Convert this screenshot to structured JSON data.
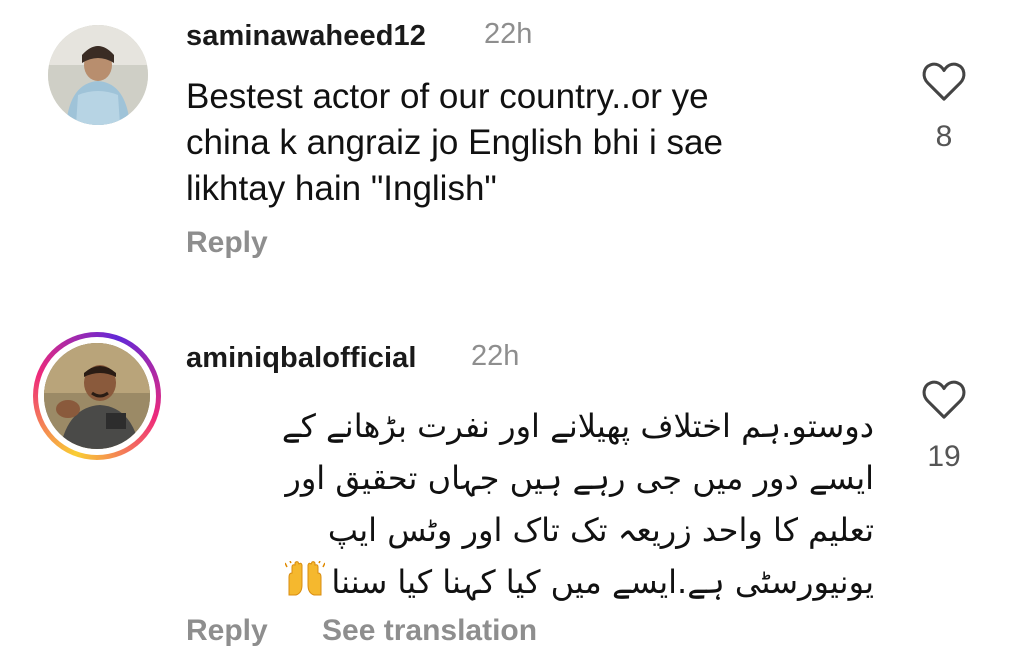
{
  "comments": [
    {
      "username": "saminawaheed12",
      "time": "22h",
      "text_lines": [
        "Bestest actor of our country..or ye",
        "china k angraiz jo English bhi i sae",
        "likhtay hain \"Inglish\""
      ],
      "reply_label": "Reply",
      "like_count": "8"
    },
    {
      "username": "aminiqbalofficial",
      "time": "22h",
      "text_lines": [
        "دوستو.ہم اختلاف پھیلانے اور نفرت بڑھانے کے",
        "ایسے دور میں جی رہے ہیں جہاں تحقیق اور",
        "تعلیم کا واحد زریعہ تک تاک اور وٹس ایپ",
        "یونیورسٹی ہے.ایسے میں کیا کہنا کیا سننا"
      ],
      "emoji": "🙌",
      "reply_label": "Reply",
      "see_translation_label": "See translation",
      "like_count": "19"
    }
  ],
  "icons": {
    "like": "heart-icon",
    "emoji": "raised-hands"
  },
  "colors": {
    "secondary_text": "#8e8e8e",
    "story_ring": [
      "#f9ce34",
      "#ee2a7b",
      "#6228d7"
    ]
  }
}
